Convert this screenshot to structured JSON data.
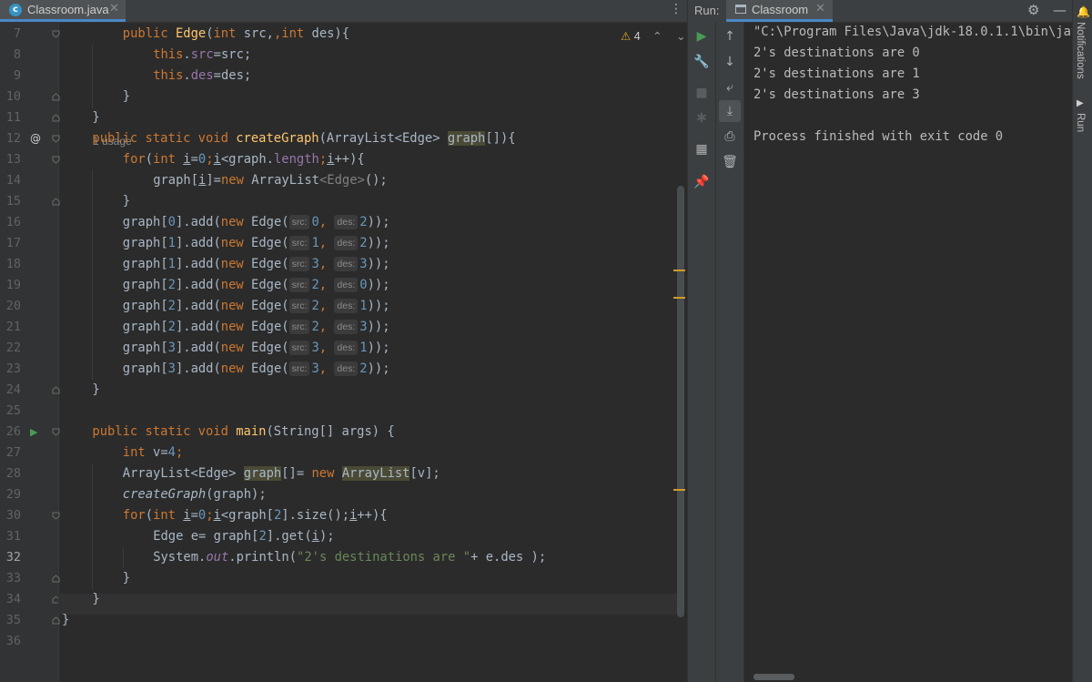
{
  "editor": {
    "tab": {
      "label": "Classroom.java",
      "icon": "c"
    },
    "inspection": {
      "count": "4"
    },
    "usage_hint": "1 usage",
    "line_numbers": [
      "7",
      "8",
      "9",
      "10",
      "11",
      "12",
      "13",
      "14",
      "15",
      "16",
      "17",
      "18",
      "19",
      "20",
      "21",
      "22",
      "23",
      "24",
      "25",
      "26",
      "27",
      "28",
      "29",
      "30",
      "31",
      "32",
      "33",
      "34",
      "35",
      "36"
    ],
    "hints": {
      "src": "src:",
      "des": "des:"
    },
    "code": {
      "l7": [
        "public",
        "Edge",
        "(",
        "int",
        " src,",
        "int",
        " des){"
      ],
      "l8": [
        "this",
        ".",
        "src",
        "=src;"
      ],
      "l9": [
        "this",
        ".",
        "des",
        "=des;"
      ],
      "l10": [
        "}"
      ],
      "l11": [
        "}"
      ],
      "l12": [
        "public static void",
        "createGraph",
        "(ArrayList<Edge> ",
        "graph",
        "[]){"
      ],
      "l13": [
        "for",
        "(",
        "int ",
        "i",
        "=",
        "0",
        ";",
        "i",
        "<graph.",
        "length",
        ";",
        "i",
        "++){"
      ],
      "l14": [
        "graph[",
        "i",
        "]=",
        "new",
        " ArrayList",
        "<Edge>",
        "();"
      ],
      "l15": [
        "}"
      ],
      "edges": [
        {
          "g": "0",
          "s": "0",
          "d": "2"
        },
        {
          "g": "1",
          "s": "1",
          "d": "2"
        },
        {
          "g": "1",
          "s": "3",
          "d": "3"
        },
        {
          "g": "2",
          "s": "2",
          "d": "0"
        },
        {
          "g": "2",
          "s": "2",
          "d": "1"
        },
        {
          "g": "2",
          "s": "2",
          "d": "3"
        },
        {
          "g": "3",
          "s": "3",
          "d": "1"
        },
        {
          "g": "3",
          "s": "3",
          "d": "2"
        }
      ],
      "edge_parts": {
        "graph": "graph[",
        "add": "].add(",
        "new": "new",
        "edge": " Edge(",
        "comma": ", ",
        "end": "));"
      },
      "l24": [
        "}"
      ],
      "l26": [
        "public static void",
        "main",
        "(String[] args) {"
      ],
      "l27": [
        "int",
        " v=",
        "4",
        ";"
      ],
      "l28": [
        "ArrayList<Edge> ",
        "graph",
        "[]= ",
        "new",
        " ",
        "ArrayList",
        "[v];"
      ],
      "l29": [
        "createGraph",
        "(graph);"
      ],
      "l30": [
        "for",
        "(",
        "int ",
        "i",
        "=",
        "0",
        ";",
        "i",
        "<graph[",
        "2",
        "].size();",
        "i",
        "++){"
      ],
      "l31": [
        "Edge e= graph[",
        "2",
        "].get(",
        "i",
        ");"
      ],
      "l32": [
        "System.",
        "out",
        ".println(",
        "\"2's destinations are \"",
        "+ e.des );"
      ],
      "l33": [
        "}"
      ],
      "l34": [
        "}"
      ],
      "l35": [
        "}"
      ]
    }
  },
  "run": {
    "label": "Run:",
    "tab": "Classroom",
    "output": [
      "\"C:\\Program Files\\Java\\jdk-18.0.1.1\\bin\\java.exe\"",
      "2's destinations are 0",
      "2's destinations are 1",
      "2's destinations are 3",
      "",
      "Process finished with exit code 0"
    ]
  },
  "side_stripe": {
    "notifications": "Notifications",
    "run": "Run"
  },
  "colors": {
    "background": "#2b2b2b",
    "keyword": "#cc7832",
    "function": "#ffc66d",
    "field": "#9876aa",
    "number": "#6897bb",
    "string": "#6a8759",
    "accent": "#4a88c7"
  }
}
